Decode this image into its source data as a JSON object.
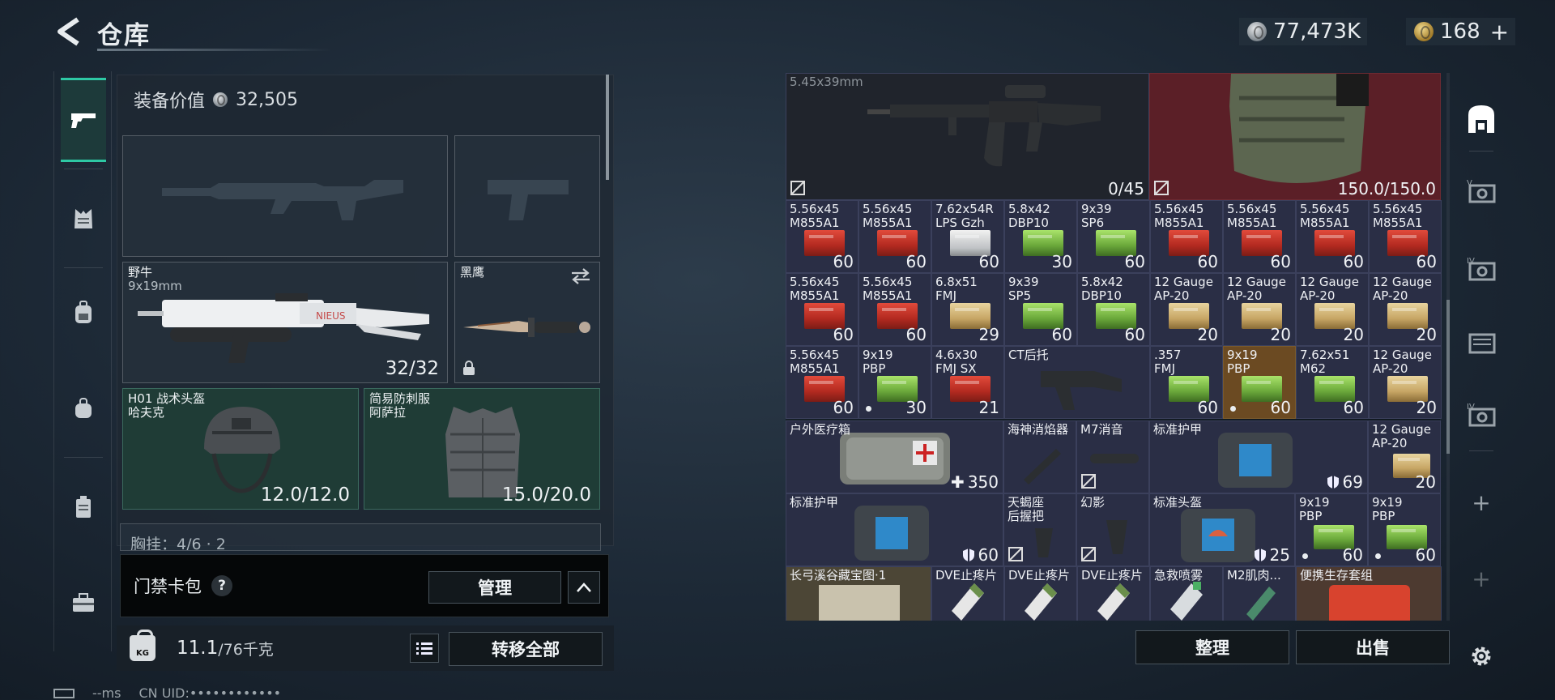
{
  "header": {
    "title": "仓库",
    "silver_amount": "77,473K",
    "gold_amount": "168",
    "add_symbol": "+"
  },
  "rail": {
    "icons": [
      "pistol-icon",
      "vest-icon",
      "backpack-icon",
      "pouch-icon",
      "container-icon",
      "toolbox-icon"
    ]
  },
  "equipment": {
    "value_label": "装备价值",
    "value_amount": "32,505",
    "primary_weapon": {
      "name": "野牛",
      "caliber": "9x19mm",
      "ammo": "32/32"
    },
    "melee": {
      "name": "黑鹰"
    },
    "helmet": {
      "name": "H01 战术头盔",
      "owner": "哈夫克",
      "durability": "12.0/12.0"
    },
    "armor": {
      "name": "简易防刺服",
      "owner": "阿萨拉",
      "durability": "15.0/20.0"
    },
    "chest_rig": {
      "label": "胸挂：4/6 · 2"
    },
    "keycard": {
      "label": "门禁卡包",
      "help": "?",
      "manage_button": "管理"
    },
    "weight": {
      "current": "11.1",
      "max": "/76千克",
      "badge": "KG",
      "transfer_button": "转移全部"
    }
  },
  "status": {
    "ping": "--ms",
    "uid": "CN UID:••••••••••••"
  },
  "stash": {
    "rifle": {
      "caliber": "5.45x39mm",
      "ammo": "0/45"
    },
    "vest": {
      "durability": "150.0/150.0"
    },
    "row1": [
      {
        "n": "5.56x45\nM855A1",
        "q": "60"
      },
      {
        "n": "5.56x45\nM855A1",
        "q": "60"
      },
      {
        "n": "7.62x54R\nLPS Gzh",
        "q": "60"
      },
      {
        "n": "5.8x42\nDBP10",
        "q": "30"
      },
      {
        "n": "9x39\nSP6",
        "q": "60"
      },
      {
        "n": "5.56x45\nM855A1",
        "q": "60"
      },
      {
        "n": "5.56x45\nM855A1",
        "q": "60"
      },
      {
        "n": "5.56x45\nM855A1",
        "q": "60"
      },
      {
        "n": "5.56x45\nM855A1",
        "q": "60"
      }
    ],
    "row2": [
      {
        "n": "5.56x45\nM855A1",
        "q": "60"
      },
      {
        "n": "5.56x45\nM855A1",
        "q": "60"
      },
      {
        "n": "6.8x51\nFMJ",
        "q": "29"
      },
      {
        "n": "9x39\nSP5",
        "q": "60"
      },
      {
        "n": "5.8x42\nDBP10",
        "q": "60"
      },
      {
        "n": "12 Gauge\nAP-20",
        "q": "20"
      },
      {
        "n": "12 Gauge\nAP-20",
        "q": "20"
      },
      {
        "n": "12 Gauge\nAP-20",
        "q": "20"
      },
      {
        "n": "12 Gauge\nAP-20",
        "q": "20"
      }
    ],
    "row3": [
      {
        "n": "5.56x45\nM855A1",
        "q": "60"
      },
      {
        "n": "9x19\nPBP",
        "q": "30"
      },
      {
        "n": "4.6x30\nFMJ SX",
        "q": "21"
      },
      {
        "n": "CT后托",
        "q": ""
      },
      {
        "n": ".357\nFMJ",
        "q": "60"
      },
      {
        "n": "9x19\nPBP",
        "q": "60"
      },
      {
        "n": "7.62x51\nM62",
        "q": "60"
      },
      {
        "n": "12 Gauge\nAP-20",
        "q": "20"
      }
    ],
    "medkit": {
      "name": "户外医疗箱",
      "uses": "350"
    },
    "suppressor1": {
      "name": "海神消焰器"
    },
    "suppressor2": {
      "name": "M7消音"
    },
    "armor_a": {
      "name": "标准护甲",
      "dur": "69"
    },
    "shell_a": {
      "name": "12 Gauge\nAP-20",
      "q": "20"
    },
    "armor_b": {
      "name": "标准护甲",
      "dur": "60"
    },
    "grip1": {
      "name": "天蝎座\n后握把"
    },
    "grip2": {
      "name": "幻影"
    },
    "helmet_b": {
      "name": "标准头盔",
      "dur": "25"
    },
    "pbp1": {
      "name": "9x19\nPBP",
      "q": "60"
    },
    "pbp2": {
      "name": "9x19\nPBP",
      "q": "60"
    },
    "row6": [
      "长弓溪谷藏宝图·1",
      "DVE止疼片",
      "DVE止疼片",
      "DVE止疼片",
      "急救喷雾",
      "M2肌肉...",
      "便携生存套组"
    ],
    "sort_button": "整理",
    "sell_button": "出售"
  },
  "colors": {
    "accent": "#2ec8a4",
    "slot_green": "#1f3c36",
    "stash_cell": "#2a2e45",
    "stash_red": "#5a1e26"
  }
}
